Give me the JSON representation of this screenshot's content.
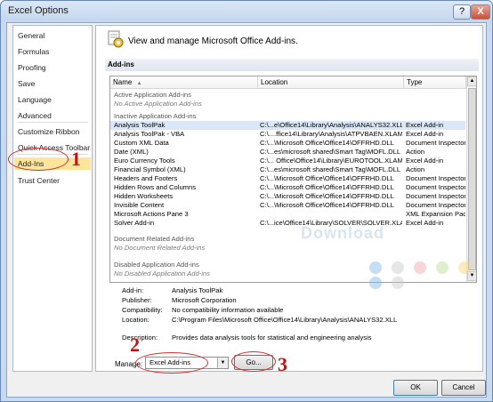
{
  "window": {
    "title": "Excel Options",
    "help_label": "?",
    "close_label": "X"
  },
  "sidebar": {
    "items": [
      {
        "label": "General"
      },
      {
        "label": "Formulas"
      },
      {
        "label": "Proofing"
      },
      {
        "label": "Save"
      },
      {
        "label": "Language"
      },
      {
        "label": "Advanced"
      },
      {
        "label": "Customize Ribbon"
      },
      {
        "label": "Quick Access Toolbar"
      },
      {
        "label": "Add-Ins"
      },
      {
        "label": "Trust Center"
      }
    ]
  },
  "header": {
    "text": "View and manage Microsoft Office Add-ins."
  },
  "section": {
    "title": "Add-ins"
  },
  "grid": {
    "columns": [
      "Name",
      "Location",
      "Type"
    ],
    "sort_indicator": "▲",
    "groups": [
      {
        "title": "Active Application Add-ins",
        "note": "No Active Application Add-ins"
      },
      {
        "title": "Inactive Application Add-ins"
      },
      {
        "title": "Document Related Add-ins",
        "note": "No Document Related Add-ins"
      },
      {
        "title": "Disabled Application Add-ins",
        "note": "No Disabled Application Add-ins"
      }
    ],
    "rows": [
      {
        "name": "Analysis ToolPak",
        "location": "C:\\...e\\Office14\\Library\\Analysis\\ANALYS32.XLL",
        "type": "Excel Add-in"
      },
      {
        "name": "Analysis ToolPak - VBA",
        "location": "C:\\....ffice14\\Library\\Analysis\\ATPVBAEN.XLAM",
        "type": "Excel Add-in"
      },
      {
        "name": "Custom XML Data",
        "location": "C:\\...\\Microsoft Office\\Office14\\OFFRHD.DLL",
        "type": "Document Inspector"
      },
      {
        "name": "Date (XML)",
        "location": "C:\\...es\\microsoft shared\\Smart Tag\\MOFL.DLL",
        "type": "Action"
      },
      {
        "name": "Euro Currency Tools",
        "location": "C:\\... Office\\Office14\\Library\\EUROTOOL.XLAM",
        "type": "Excel Add-in"
      },
      {
        "name": "Financial Symbol (XML)",
        "location": "C:\\...es\\microsoft shared\\Smart Tag\\MOFL.DLL",
        "type": "Action"
      },
      {
        "name": "Headers and Footers",
        "location": "C:\\...\\Microsoft Office\\Office14\\OFFRHD.DLL",
        "type": "Document Inspector"
      },
      {
        "name": "Hidden Rows and Columns",
        "location": "C:\\...\\Microsoft Office\\Office14\\OFFRHD.DLL",
        "type": "Document Inspector"
      },
      {
        "name": "Hidden Worksheets",
        "location": "C:\\...\\Microsoft Office\\Office14\\OFFRHD.DLL",
        "type": "Document Inspector"
      },
      {
        "name": "Invisible Content",
        "location": "C:\\...\\Microsoft Office\\Office14\\OFFRHD.DLL",
        "type": "Document Inspector"
      },
      {
        "name": "Microsoft Actions Pane 3",
        "location": "",
        "type": "XML Expansion Pack"
      },
      {
        "name": "Solver Add-in",
        "location": "C:\\...ice\\Office14\\Library\\SOLVER\\SOLVER.XLAM",
        "type": "Excel Add-in"
      }
    ]
  },
  "details": {
    "addin_label": "Add-in:",
    "addin_value": "Analysis ToolPak",
    "publisher_label": "Publisher:",
    "publisher_value": "Microsoft Corporation",
    "compat_label": "Compatibility:",
    "compat_value": "No compatibility information available",
    "location_label": "Location:",
    "location_value": "C:\\Program Files\\Microsoft Office\\Office14\\Library\\Analysis\\ANALYS32.XLL",
    "description_label": "Description:",
    "description_value": "Provides data analysis tools for statistical and engineering analysis"
  },
  "manage": {
    "label": "Manage:",
    "selected": "Excel Add-ins",
    "go_label": "Go..."
  },
  "footer": {
    "ok_label": "OK",
    "cancel_label": "Cancel"
  },
  "annotations": {
    "m1": "1",
    "m2": "2",
    "m3": "3"
  },
  "watermark": {
    "text": "Download"
  },
  "colors": {
    "accent": "#c41010",
    "selection": "#d9e7f8",
    "active_sidebar": "#ffe59b"
  }
}
